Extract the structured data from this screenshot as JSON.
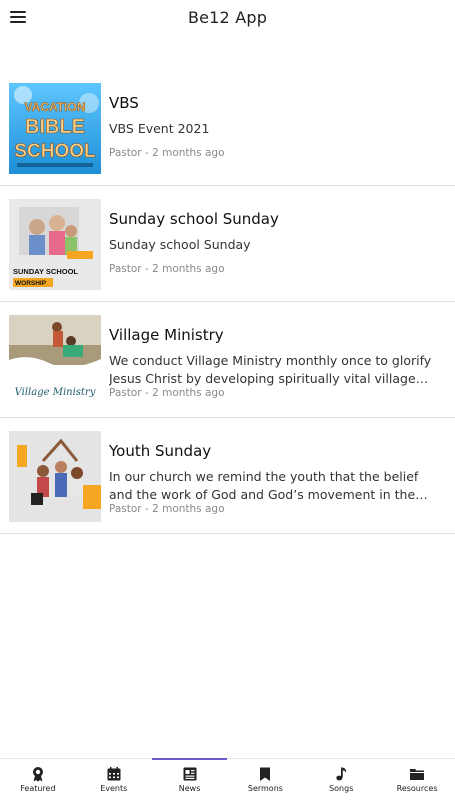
{
  "app": {
    "title": "Be12 App"
  },
  "news": [
    {
      "title": "VBS",
      "description": "VBS Event 2021",
      "meta": "Pastor - 2 months ago",
      "thumb_text": [
        "VACATION",
        "BIBLE",
        "SCHOOL"
      ]
    },
    {
      "title": "Sunday school Sunday",
      "description": "Sunday school Sunday",
      "meta": "Pastor - 2 months ago",
      "thumb_text": [
        "SUNDAY SCHOOL",
        "WORSHIP"
      ]
    },
    {
      "title": "Village Ministry",
      "description": "We conduct Village Ministry monthly once to glorify Jesus Christ by developing spiritually vital village congregations.",
      "meta": "Pastor - 2 months ago",
      "thumb_text": [
        "Village Ministry"
      ]
    },
    {
      "title": "Youth Sunday",
      "description": "In our church we remind the youth that the belief and the work of God and God’s movement in the world is alive.",
      "meta": "Pastor - 2 months ago",
      "thumb_text": []
    }
  ],
  "nav": [
    {
      "label": "Featured",
      "icon": "award-icon"
    },
    {
      "label": "Events",
      "icon": "calendar-icon"
    },
    {
      "label": "News",
      "icon": "newspaper-icon",
      "active": true
    },
    {
      "label": "Sermons",
      "icon": "bookmark-icon"
    },
    {
      "label": "Songs",
      "icon": "music-note-icon"
    },
    {
      "label": "Resources",
      "icon": "folder-icon"
    }
  ],
  "colors": {
    "accent": "#6a5acd",
    "meta": "#8a8a8a",
    "divider": "#e2e2e2"
  }
}
